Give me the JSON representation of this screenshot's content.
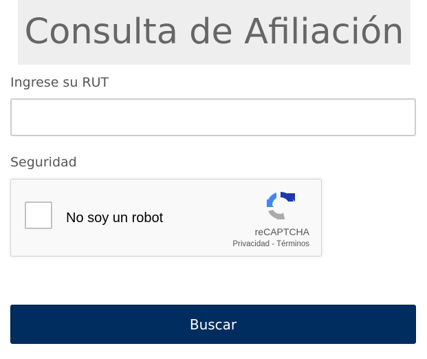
{
  "header": {
    "title": "Consulta de Afiliación"
  },
  "form": {
    "rut_label": "Ingrese su RUT",
    "rut_value": "",
    "security_label": "Seguridad",
    "submit_label": "Buscar"
  },
  "captcha": {
    "checkbox_label": "No soy un robot",
    "brand": "reCAPTCHA",
    "privacy_link": "Privacidad",
    "separator": " - ",
    "terms_link": "Términos",
    "checked": false
  },
  "colors": {
    "title_background": "#eeeeee",
    "title_text": "#666666",
    "button_background": "#002d5f",
    "recaptcha_blue": "#1c3aa9",
    "recaptcha_light_blue": "#4285f4",
    "recaptcha_gray": "#ababab"
  }
}
